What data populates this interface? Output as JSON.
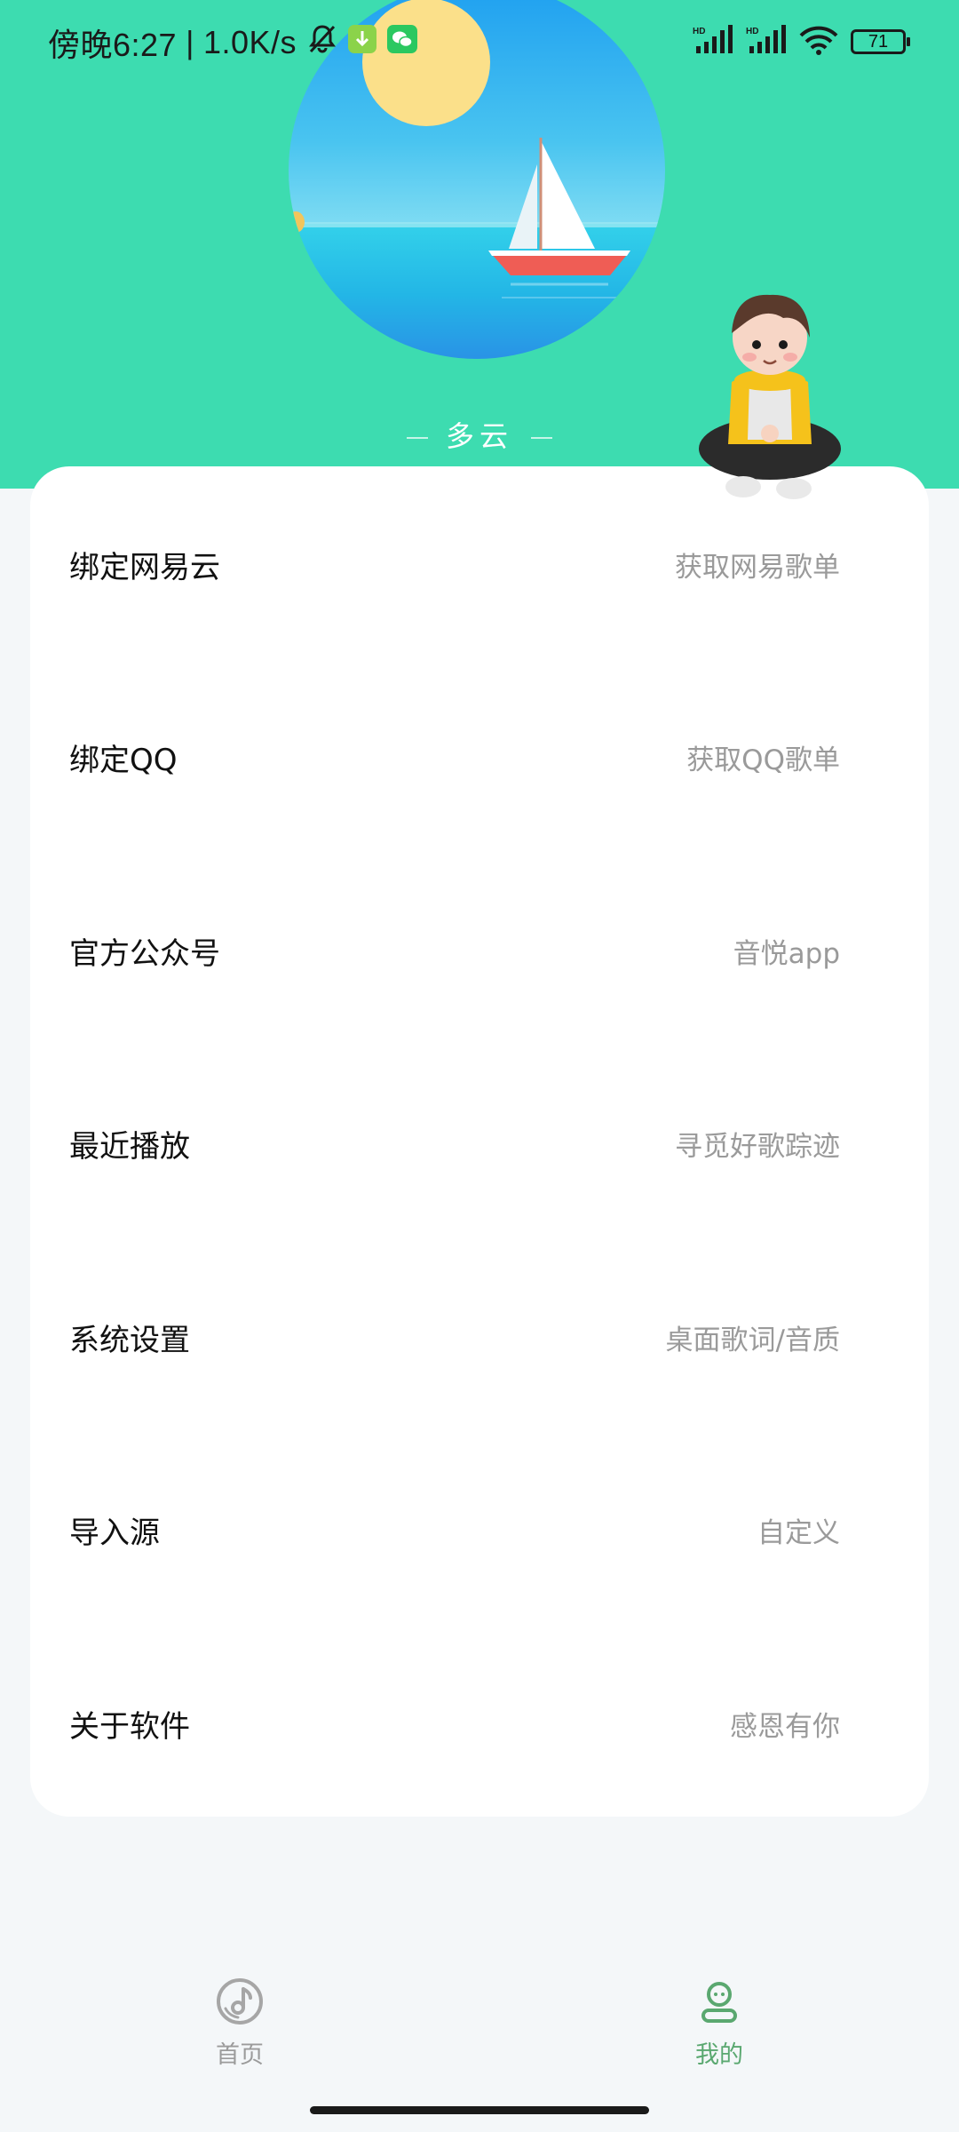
{
  "status_bar": {
    "time": "傍晚6:27",
    "net_speed": "1.0K/s",
    "battery": "71",
    "signal1_label": "HD",
    "signal2_label": "HD"
  },
  "header": {
    "weather": "多云"
  },
  "menu": [
    {
      "title": "绑定网易云",
      "subtitle": "获取网易歌单"
    },
    {
      "title": "绑定QQ",
      "subtitle": "获取QQ歌单"
    },
    {
      "title": "官方公众号",
      "subtitle": "音悦app"
    },
    {
      "title": "最近播放",
      "subtitle": "寻觅好歌踪迹"
    },
    {
      "title": "系统设置",
      "subtitle": "桌面歌词/音质"
    },
    {
      "title": "导入源",
      "subtitle": "自定义"
    },
    {
      "title": "关于软件",
      "subtitle": "感恩有你"
    }
  ],
  "nav": {
    "home": "首页",
    "me": "我的"
  },
  "colors": {
    "header_bg": "#3ddcb0",
    "active_nav": "#5aa870",
    "inactive_nav": "#9b9b9b"
  }
}
